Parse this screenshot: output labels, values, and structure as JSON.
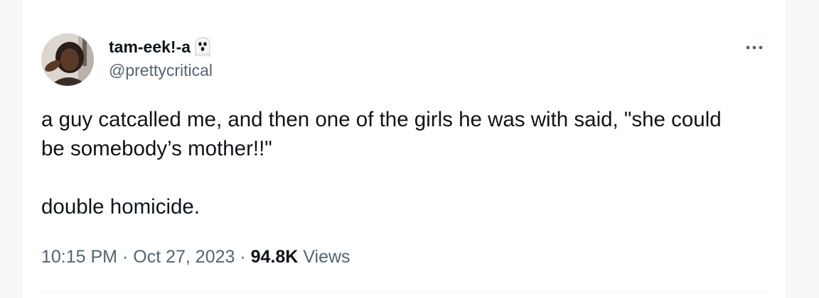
{
  "user": {
    "display_name": "tam-eek!-a",
    "handle": "@prettycritical",
    "badge_icon": "ghost-emoji"
  },
  "tweet": {
    "text": "a guy catcalled me, and then one of the girls he was with said, \"she could\nbe somebody’s mother!!\"\n\ndouble homicide."
  },
  "meta": {
    "time": "10:15 PM",
    "separator": "·",
    "date": "Oct 27, 2023",
    "views_count": "94.8K",
    "views_label": "Views"
  },
  "colors": {
    "text": "#0f1419",
    "secondary": "#536471",
    "border": "#eff3f4"
  }
}
